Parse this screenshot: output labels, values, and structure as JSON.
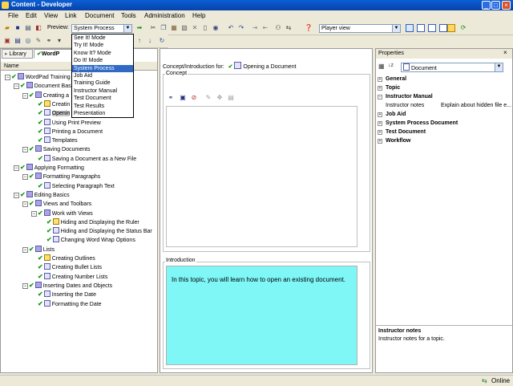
{
  "window": {
    "title": "Content - Developer"
  },
  "menu": [
    "File",
    "Edit",
    "View",
    "Link",
    "Document",
    "Tools",
    "Administration",
    "Help"
  ],
  "toolbar": {
    "preview_label": "Preview:",
    "preview_value": "System Process",
    "player_value": "Player view"
  },
  "preview_options": [
    "See It! Mode",
    "Try It! Mode",
    "Know It? Mode",
    "Do It! Mode",
    "System Process",
    "Job Aid",
    "Training Guide",
    "Instructor Manual",
    "Test Document",
    "Test Results",
    "Presentation"
  ],
  "preview_selected_index": 4,
  "left": {
    "tabs": [
      "Library",
      "WordP"
    ],
    "column_header": "Name",
    "tree": [
      {
        "label": "WordPad Training",
        "indent": 0,
        "icon": "book",
        "exp": "-"
      },
      {
        "label": "Document Basics",
        "indent": 1,
        "icon": "book",
        "exp": "-"
      },
      {
        "label": "Creating a",
        "indent": 2,
        "icon": "book",
        "exp": "-"
      },
      {
        "label": "Creatin",
        "indent": 3,
        "icon": "quiz",
        "exp": ""
      },
      {
        "label": "Openin",
        "indent": 3,
        "icon": "topic",
        "exp": "",
        "highlight": true
      },
      {
        "label": "Using Print Preview",
        "indent": 3,
        "icon": "topic",
        "exp": ""
      },
      {
        "label": "Printing a Document",
        "indent": 3,
        "icon": "topic",
        "exp": ""
      },
      {
        "label": "Templates",
        "indent": 3,
        "icon": "topic",
        "exp": ""
      },
      {
        "label": "Saving Documents",
        "indent": 2,
        "icon": "book",
        "exp": "-"
      },
      {
        "label": "Saving a Document as a New File",
        "indent": 3,
        "icon": "topic",
        "exp": ""
      },
      {
        "label": "Applying Formatting",
        "indent": 1,
        "icon": "book",
        "exp": "-"
      },
      {
        "label": "Formatting Paragraphs",
        "indent": 2,
        "icon": "book",
        "exp": "-"
      },
      {
        "label": "Selecting Paragraph Text",
        "indent": 3,
        "icon": "topic",
        "exp": ""
      },
      {
        "label": "Editing Basics",
        "indent": 1,
        "icon": "book",
        "exp": "-"
      },
      {
        "label": "Views and Toolbars",
        "indent": 2,
        "icon": "book",
        "exp": "-"
      },
      {
        "label": "Work with Views",
        "indent": 3,
        "icon": "book",
        "exp": "-"
      },
      {
        "label": "Hiding and Displaying the Ruler",
        "indent": 4,
        "icon": "quiz",
        "exp": ""
      },
      {
        "label": "Hiding and Displaying the Status Bar",
        "indent": 4,
        "icon": "topic",
        "exp": ""
      },
      {
        "label": "Changing Word Wrap Options",
        "indent": 4,
        "icon": "topic",
        "exp": ""
      },
      {
        "label": "Lists",
        "indent": 2,
        "icon": "book",
        "exp": "-"
      },
      {
        "label": "Creating Outlines",
        "indent": 3,
        "icon": "quiz",
        "exp": ""
      },
      {
        "label": "Creating Bullet Lists",
        "indent": 3,
        "icon": "topic",
        "exp": ""
      },
      {
        "label": "Creating Number Lists",
        "indent": 3,
        "icon": "topic",
        "exp": ""
      },
      {
        "label": "Inserting Dates and Objects",
        "indent": 2,
        "icon": "book",
        "exp": "-"
      },
      {
        "label": "Inserting the Date",
        "indent": 3,
        "icon": "topic",
        "exp": ""
      },
      {
        "label": "Formatting the Date",
        "indent": 3,
        "icon": "topic",
        "exp": ""
      }
    ]
  },
  "center": {
    "header_label": "Concept/Introduction for:",
    "header_value": "Opening a Document",
    "concept_label": "Concept",
    "intro_label": "Introduction",
    "intro_text": "In this topic, you will learn how to open an existing document."
  },
  "properties": {
    "title": "Properties",
    "object_value": "Document",
    "rows": [
      {
        "label": "General",
        "bold": true,
        "exp": "+"
      },
      {
        "label": "Topic",
        "bold": true,
        "exp": "+"
      },
      {
        "label": "Instructor Manual",
        "bold": true,
        "exp": "-"
      },
      {
        "label": "Instructor notes",
        "bold": false,
        "exp": "",
        "value": "Explain about hidden file e..."
      },
      {
        "label": "Job Aid",
        "bold": true,
        "exp": "+"
      },
      {
        "label": "System Process Document",
        "bold": true,
        "exp": "+"
      },
      {
        "label": "Test Document",
        "bold": true,
        "exp": "+"
      },
      {
        "label": "Workflow",
        "bold": true,
        "exp": "+"
      }
    ],
    "desc_title": "Instructor notes",
    "desc_text": "Instructor notes for a topic."
  },
  "status": {
    "online": "Online"
  },
  "colors": {
    "intro_bg": "#7ff7f7",
    "selection": "#316ac5",
    "check": "#1a9a1a"
  }
}
